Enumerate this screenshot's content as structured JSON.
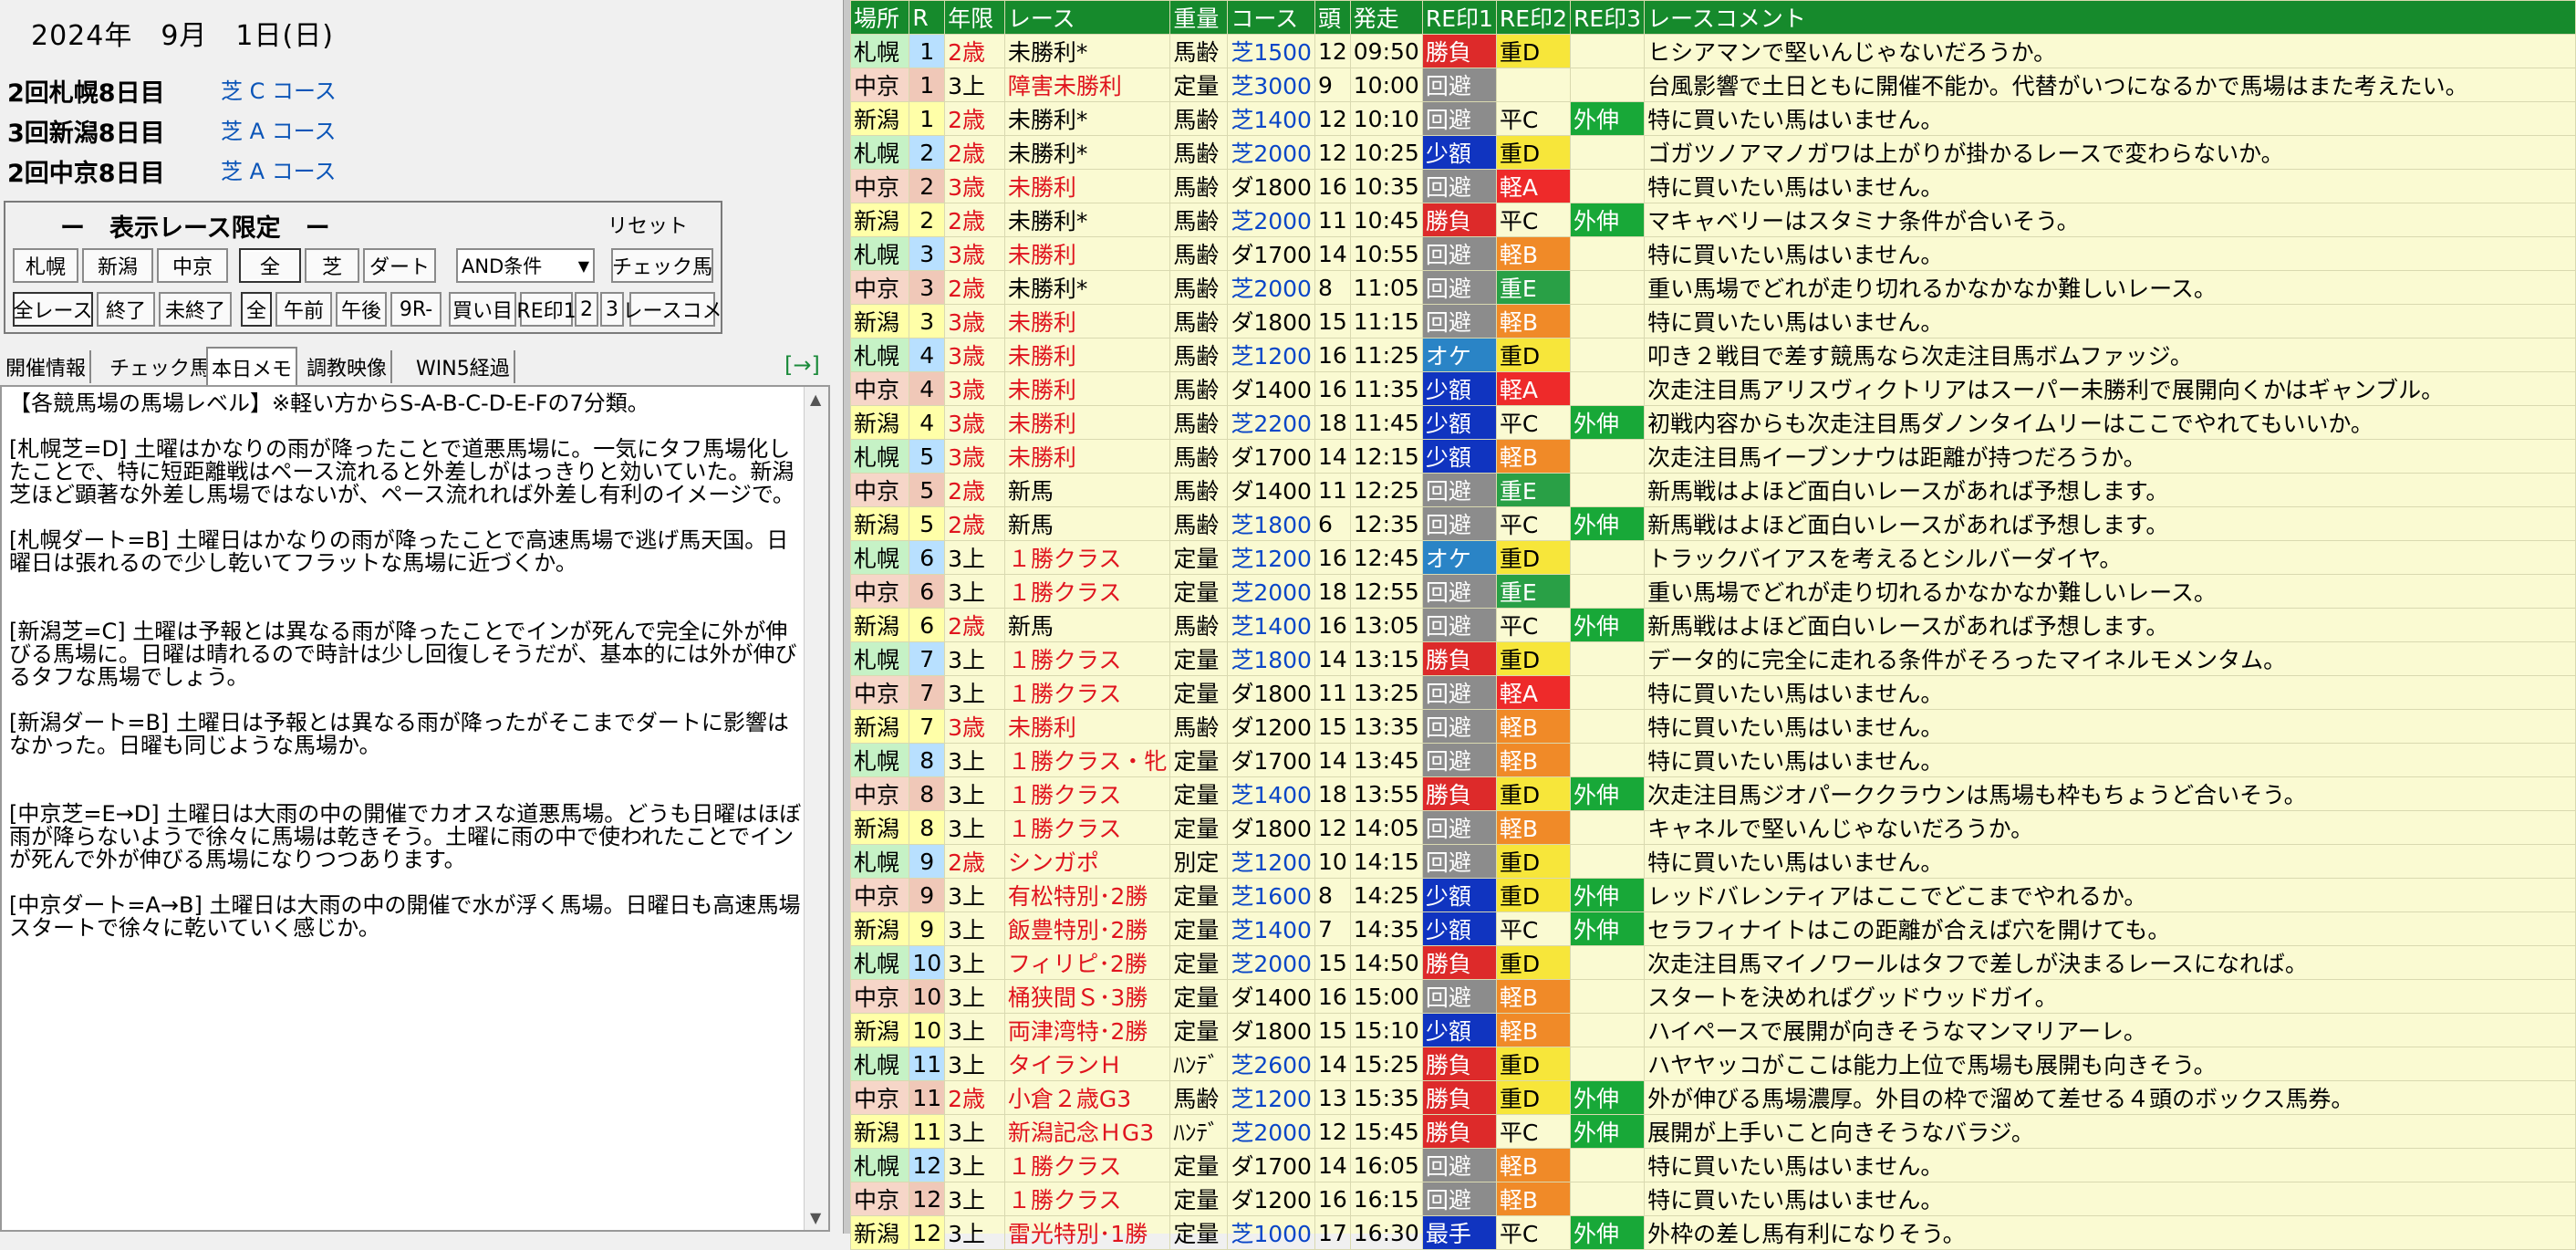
{
  "date": "2024年　9月　1日(日)",
  "meetings": [
    {
      "name": "2回札幌8日目",
      "course": "芝 C コース"
    },
    {
      "name": "3回新潟8日目",
      "course": "芝 A コース"
    },
    {
      "name": "2回中京8日目",
      "course": "芝 A コース"
    }
  ],
  "filter": {
    "title": "ー　表示レース限定　ー",
    "reset": "リセット",
    "venues": [
      "札幌",
      "新潟",
      "中京"
    ],
    "surfaces": [
      "全",
      "芝",
      "ダート"
    ],
    "condition": "AND条件",
    "check_horse": "チェック馬",
    "status": [
      "全レース",
      "終了",
      "未終了"
    ],
    "time": [
      "全",
      "午前",
      "午後",
      "9R-"
    ],
    "buy": "買い目",
    "recs": [
      "RE印1",
      "2",
      "3"
    ],
    "comment": "レースコメ"
  },
  "tabs": [
    "開催情報",
    "チェック馬",
    "本日メモ",
    "調教映像",
    "WIN5経過"
  ],
  "tab_arrow": "[→]",
  "memo": "【各競馬場の馬場レベル】※軽い方からS-A-B-C-D-E-Fの7分類。\n\n[札幌芝=D] 土曜はかなりの雨が降ったことで道悪馬場に。一気にタフ馬場化したことで、特に短距離戦はペース流れると外差しがはっきりと効いていた。新潟芝ほど顕著な外差し馬場ではないが、ペース流れれば外差し有利のイメージで。\n\n[札幌ダート=B] 土曜日はかなりの雨が降ったことで高速馬場で逃げ馬天国。日曜日は張れるので少し乾いてフラットな馬場に近づくか。\n\n\n[新潟芝=C] 土曜は予報とは異なる雨が降ったことでインが死んで完全に外が伸びる馬場に。日曜は晴れるので時計は少し回復しそうだが、基本的には外が伸びるタフな馬場でしょう。\n\n[新潟ダート=B] 土曜日は予報とは異なる雨が降ったがそこまでダートに影響はなかった。日曜も同じような馬場か。\n\n\n[中京芝=E→D] 土曜日は大雨の中の開催でカオスな道悪馬場。どうも日曜はほぼ雨が降らないようで徐々に馬場は乾きそう。土曜に雨の中で使われたことでインが死んで外が伸びる馬場になりつつあります。\n\n[中京ダート=A→B] 土曜日は大雨の中の開催で水が浮く馬場。日曜日も高速馬場スタートで徐々に乾いていく感じか。",
  "headers": [
    "場所",
    "R",
    "年限",
    "レース",
    "重量",
    "コース",
    "頭",
    "発走",
    "RE印1",
    "RE印2",
    "RE印3",
    "レースコメント"
  ],
  "rows": [
    [
      "札幌",
      "1",
      "2歳",
      "未勝利*",
      "馬齢",
      "芝1500",
      "12",
      "09:50",
      "勝負",
      "重D",
      "",
      "ヒシアマンで堅いんじゃないだろうか。"
    ],
    [
      "中京",
      "1",
      "3上",
      "障害未勝利",
      "定量",
      "芝3000",
      "9",
      "10:00",
      "回避",
      "",
      "",
      "台風影響で土日ともに開催不能か。代替がいつになるかで馬場はまた考えたい。"
    ],
    [
      "新潟",
      "1",
      "2歳",
      "未勝利*",
      "馬齢",
      "芝1400",
      "12",
      "10:10",
      "回避",
      "平C",
      "外伸",
      "特に買いたい馬はいません。"
    ],
    [
      "札幌",
      "2",
      "2歳",
      "未勝利*",
      "馬齢",
      "芝2000",
      "12",
      "10:25",
      "少額",
      "重D",
      "",
      "ゴガツノアマノガワは上がりが掛かるレースで変わらないか。"
    ],
    [
      "中京",
      "2",
      "3歳",
      "未勝利",
      "馬齢",
      "ダ1800",
      "16",
      "10:35",
      "回避",
      "軽A",
      "",
      "特に買いたい馬はいません。"
    ],
    [
      "新潟",
      "2",
      "2歳",
      "未勝利*",
      "馬齢",
      "芝2000",
      "11",
      "10:45",
      "勝負",
      "平C",
      "外伸",
      "マキャベリーはスタミナ条件が合いそう。"
    ],
    [
      "札幌",
      "3",
      "3歳",
      "未勝利",
      "馬齢",
      "ダ1700",
      "14",
      "10:55",
      "回避",
      "軽B",
      "",
      "特に買いたい馬はいません。"
    ],
    [
      "中京",
      "3",
      "2歳",
      "未勝利*",
      "馬齢",
      "芝2000",
      "8",
      "11:05",
      "回避",
      "重E",
      "",
      "重い馬場でどれが走り切れるかなかなか難しいレース。"
    ],
    [
      "新潟",
      "3",
      "3歳",
      "未勝利",
      "馬齢",
      "ダ1800",
      "15",
      "11:15",
      "回避",
      "軽B",
      "",
      "特に買いたい馬はいません。"
    ],
    [
      "札幌",
      "4",
      "3歳",
      "未勝利",
      "馬齢",
      "芝1200",
      "16",
      "11:25",
      "オケ",
      "重D",
      "",
      "叩き２戦目で差す競馬なら次走注目馬ボムファッジ。"
    ],
    [
      "中京",
      "4",
      "3歳",
      "未勝利",
      "馬齢",
      "ダ1400",
      "16",
      "11:35",
      "少額",
      "軽A",
      "",
      "次走注目馬アリスヴィクトリアはスーパー未勝利で展開向くかはギャンブル。"
    ],
    [
      "新潟",
      "4",
      "3歳",
      "未勝利",
      "馬齢",
      "芝2200",
      "18",
      "11:45",
      "少額",
      "平C",
      "外伸",
      "初戦内容からも次走注目馬ダノンタイムリーはここでやれてもいいか。"
    ],
    [
      "札幌",
      "5",
      "3歳",
      "未勝利",
      "馬齢",
      "ダ1700",
      "14",
      "12:15",
      "少額",
      "軽B",
      "",
      "次走注目馬イーブンナウは距離が持つだろうか。"
    ],
    [
      "中京",
      "5",
      "2歳",
      "新馬",
      "馬齢",
      "ダ1400",
      "11",
      "12:25",
      "回避",
      "重E",
      "",
      "新馬戦はよほど面白いレースがあれば予想します。"
    ],
    [
      "新潟",
      "5",
      "2歳",
      "新馬",
      "馬齢",
      "芝1800",
      "6",
      "12:35",
      "回避",
      "平C",
      "外伸",
      "新馬戦はよほど面白いレースがあれば予想します。"
    ],
    [
      "札幌",
      "6",
      "3上",
      "１勝クラス",
      "定量",
      "芝1200",
      "16",
      "12:45",
      "オケ",
      "重D",
      "",
      "トラックバイアスを考えるとシルバーダイヤ。"
    ],
    [
      "中京",
      "6",
      "3上",
      "１勝クラス",
      "定量",
      "芝2000",
      "18",
      "12:55",
      "回避",
      "重E",
      "",
      "重い馬場でどれが走り切れるかなかなか難しいレース。"
    ],
    [
      "新潟",
      "6",
      "2歳",
      "新馬",
      "馬齢",
      "芝1400",
      "16",
      "13:05",
      "回避",
      "平C",
      "外伸",
      "新馬戦はよほど面白いレースがあれば予想します。"
    ],
    [
      "札幌",
      "7",
      "3上",
      "１勝クラス",
      "定量",
      "芝1800",
      "14",
      "13:15",
      "勝負",
      "重D",
      "",
      "データ的に完全に走れる条件がそろったマイネルモメンタム。"
    ],
    [
      "中京",
      "7",
      "3上",
      "１勝クラス",
      "定量",
      "ダ1800",
      "11",
      "13:25",
      "回避",
      "軽A",
      "",
      "特に買いたい馬はいません。"
    ],
    [
      "新潟",
      "7",
      "3歳",
      "未勝利",
      "馬齢",
      "ダ1200",
      "15",
      "13:35",
      "回避",
      "軽B",
      "",
      "特に買いたい馬はいません。"
    ],
    [
      "札幌",
      "8",
      "3上",
      "１勝クラス・牝",
      "定量",
      "ダ1700",
      "14",
      "13:45",
      "回避",
      "軽B",
      "",
      "特に買いたい馬はいません。"
    ],
    [
      "中京",
      "8",
      "3上",
      "１勝クラス",
      "定量",
      "芝1400",
      "18",
      "13:55",
      "勝負",
      "重D",
      "外伸",
      "次走注目馬ジオパーククラウンは馬場も枠もちょうど合いそう。"
    ],
    [
      "新潟",
      "8",
      "3上",
      "１勝クラス",
      "定量",
      "ダ1800",
      "12",
      "14:05",
      "回避",
      "軽B",
      "",
      "キャネルで堅いんじゃないだろうか。"
    ],
    [
      "札幌",
      "9",
      "2歳",
      "シンガポ",
      "別定",
      "芝1200",
      "10",
      "14:15",
      "回避",
      "重D",
      "",
      "特に買いたい馬はいません。"
    ],
    [
      "中京",
      "9",
      "3上",
      "有松特別･2勝",
      "定量",
      "芝1600",
      "8",
      "14:25",
      "少額",
      "重D",
      "外伸",
      "レッドバレンティアはここでどこまでやれるか。"
    ],
    [
      "新潟",
      "9",
      "3上",
      "飯豊特別･2勝",
      "定量",
      "芝1400",
      "7",
      "14:35",
      "少額",
      "平C",
      "外伸",
      "セラフィナイトはこの距離が合えば穴を開けても。"
    ],
    [
      "札幌",
      "10",
      "3上",
      "フィリピ･2勝",
      "定量",
      "芝2000",
      "15",
      "14:50",
      "勝負",
      "重D",
      "",
      "次走注目馬マイノワールはタフで差しが決まるレースになれば。"
    ],
    [
      "中京",
      "10",
      "3上",
      "桶狭間Ｓ･3勝",
      "定量",
      "ダ1400",
      "16",
      "15:00",
      "回避",
      "軽B",
      "",
      "スタートを決めればグッドウッドガイ。"
    ],
    [
      "新潟",
      "10",
      "3上",
      "両津湾特･2勝",
      "定量",
      "ダ1800",
      "15",
      "15:10",
      "少額",
      "軽B",
      "",
      "ハイペースで展開が向きそうなマンマリアーレ。"
    ],
    [
      "札幌",
      "11",
      "3上",
      "タイランＨ",
      "ﾊﾝﾃﾞ",
      "芝2600",
      "14",
      "15:25",
      "勝負",
      "重D",
      "",
      "ハヤヤッコがここは能力上位で馬場も展開も向きそう。"
    ],
    [
      "中京",
      "11",
      "2歳",
      "小倉２歳G3",
      "馬齢",
      "芝1200",
      "13",
      "15:35",
      "勝負",
      "重D",
      "外伸",
      "外が伸びる馬場濃厚。外目の枠で溜めて差せる４頭のボックス馬券。"
    ],
    [
      "新潟",
      "11",
      "3上",
      "新潟記念ＨG3",
      "ﾊﾝﾃﾞ",
      "芝2000",
      "12",
      "15:45",
      "勝負",
      "平C",
      "外伸",
      "展開が上手いこと向きそうなバラジ。"
    ],
    [
      "札幌",
      "12",
      "3上",
      "１勝クラス",
      "定量",
      "ダ1700",
      "14",
      "16:05",
      "回避",
      "軽B",
      "",
      "特に買いたい馬はいません。"
    ],
    [
      "中京",
      "12",
      "3上",
      "１勝クラス",
      "定量",
      "ダ1200",
      "16",
      "16:15",
      "回避",
      "軽B",
      "",
      "特に買いたい馬はいません。"
    ],
    [
      "新潟",
      "12",
      "3上",
      "雷光特別･1勝",
      "定量",
      "芝1000",
      "17",
      "16:30",
      "最手",
      "平C",
      "外伸",
      "外枠の差し馬有利になりそう。"
    ]
  ],
  "colors": {
    "header_green": "#168a2c",
    "grid_bg": "#fafad2",
    "turf_blue": "#0a46c8",
    "red": "#e0141e"
  }
}
